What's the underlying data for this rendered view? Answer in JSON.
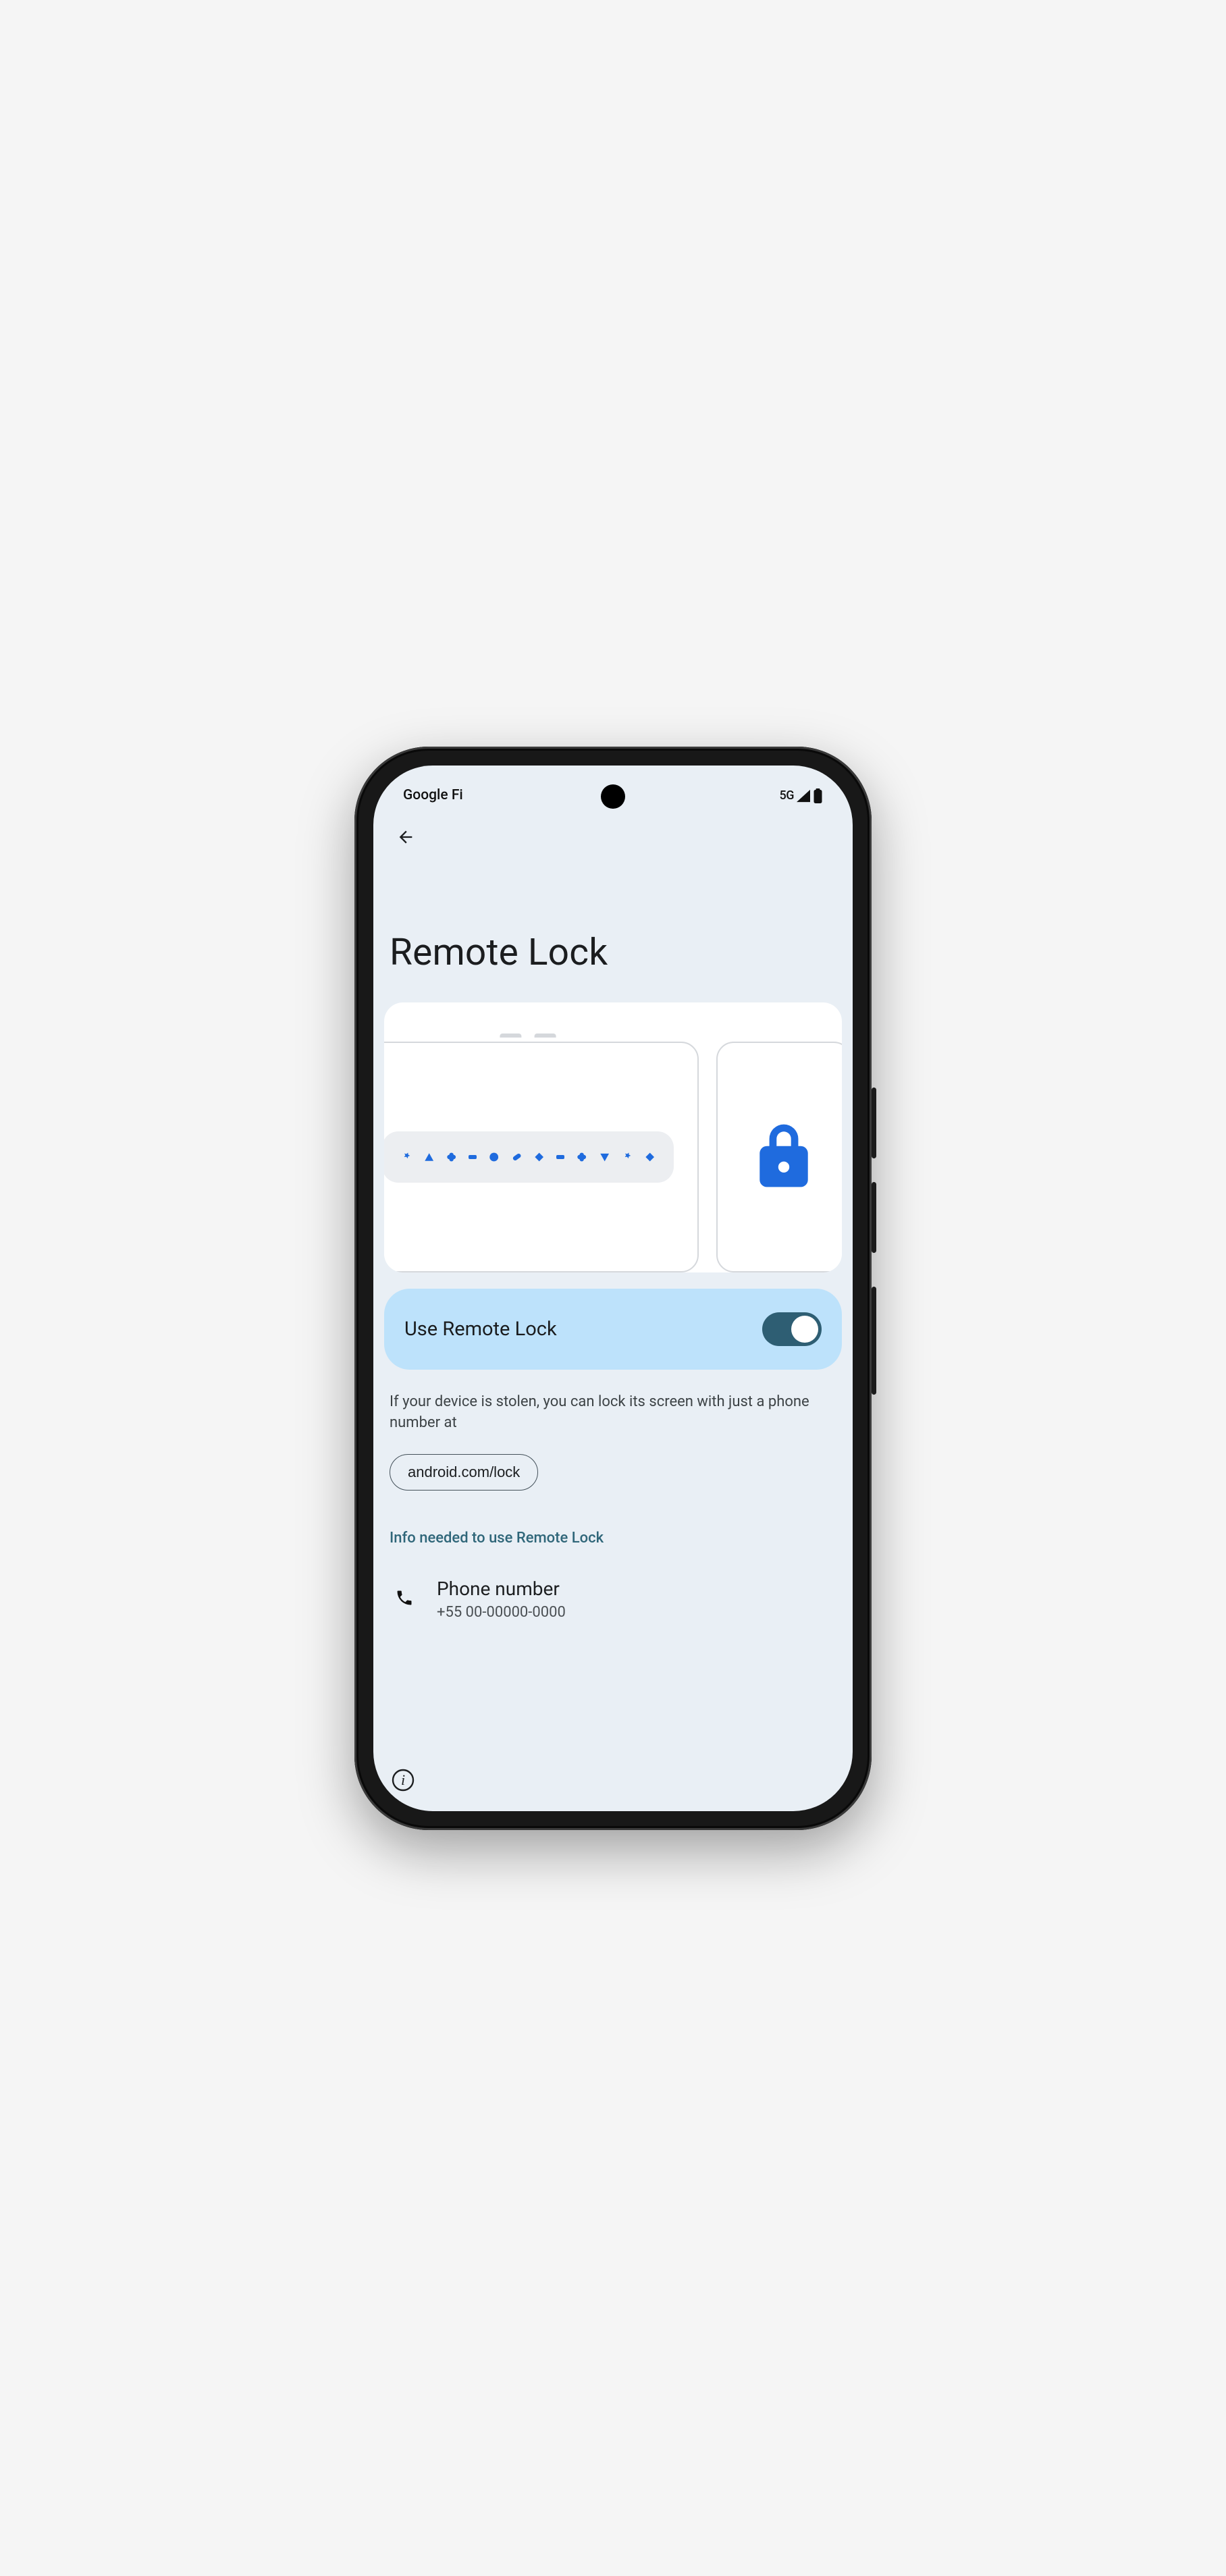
{
  "statusbar": {
    "carrier": "Google Fi",
    "network": "5G"
  },
  "page": {
    "title": "Remote Lock"
  },
  "toggle": {
    "label": "Use Remote Lock",
    "on": true
  },
  "description": "If your device is stolen, you can lock its screen with just a phone number at",
  "url_chip": "android.com/lock",
  "section_header": "Info needed to use Remote Lock",
  "phone_row": {
    "title": "Phone number",
    "value": "+55 00-00000-0000"
  },
  "icons": {
    "back": "back-arrow-icon",
    "lock": "lock-icon",
    "phone": "phone-icon",
    "info": "info-icon",
    "signal": "signal-icon",
    "battery": "battery-icon"
  }
}
